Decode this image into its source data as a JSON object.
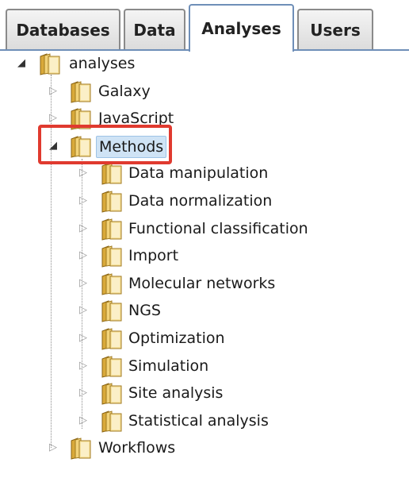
{
  "tabs": [
    {
      "label": "Databases",
      "active": false
    },
    {
      "label": "Data",
      "active": false
    },
    {
      "label": "Analyses",
      "active": true
    },
    {
      "label": "Users",
      "active": false
    }
  ],
  "tree": {
    "root": {
      "label": "analyses",
      "expanded": true
    },
    "children": [
      {
        "label": "Galaxy",
        "expanded": false
      },
      {
        "label": "JavaScript",
        "expanded": false
      },
      {
        "label": "Methods",
        "expanded": true,
        "selected": true,
        "children": [
          {
            "label": "Data manipulation"
          },
          {
            "label": "Data normalization"
          },
          {
            "label": "Functional classification"
          },
          {
            "label": "Import"
          },
          {
            "label": "Molecular networks"
          },
          {
            "label": "NGS"
          },
          {
            "label": "Optimization"
          },
          {
            "label": "Simulation"
          },
          {
            "label": "Site analysis"
          },
          {
            "label": "Statistical analysis"
          }
        ]
      },
      {
        "label": "Workflows",
        "expanded": false
      }
    ]
  },
  "icons": {
    "collapsed": "triangle-right-outline-icon",
    "expanded": "triangle-down-filled-icon",
    "folder": "folder-icon"
  },
  "colors": {
    "highlight": "#e03a2f",
    "selection": "#cfe3f5",
    "tab_border": "#6f8fb8"
  }
}
